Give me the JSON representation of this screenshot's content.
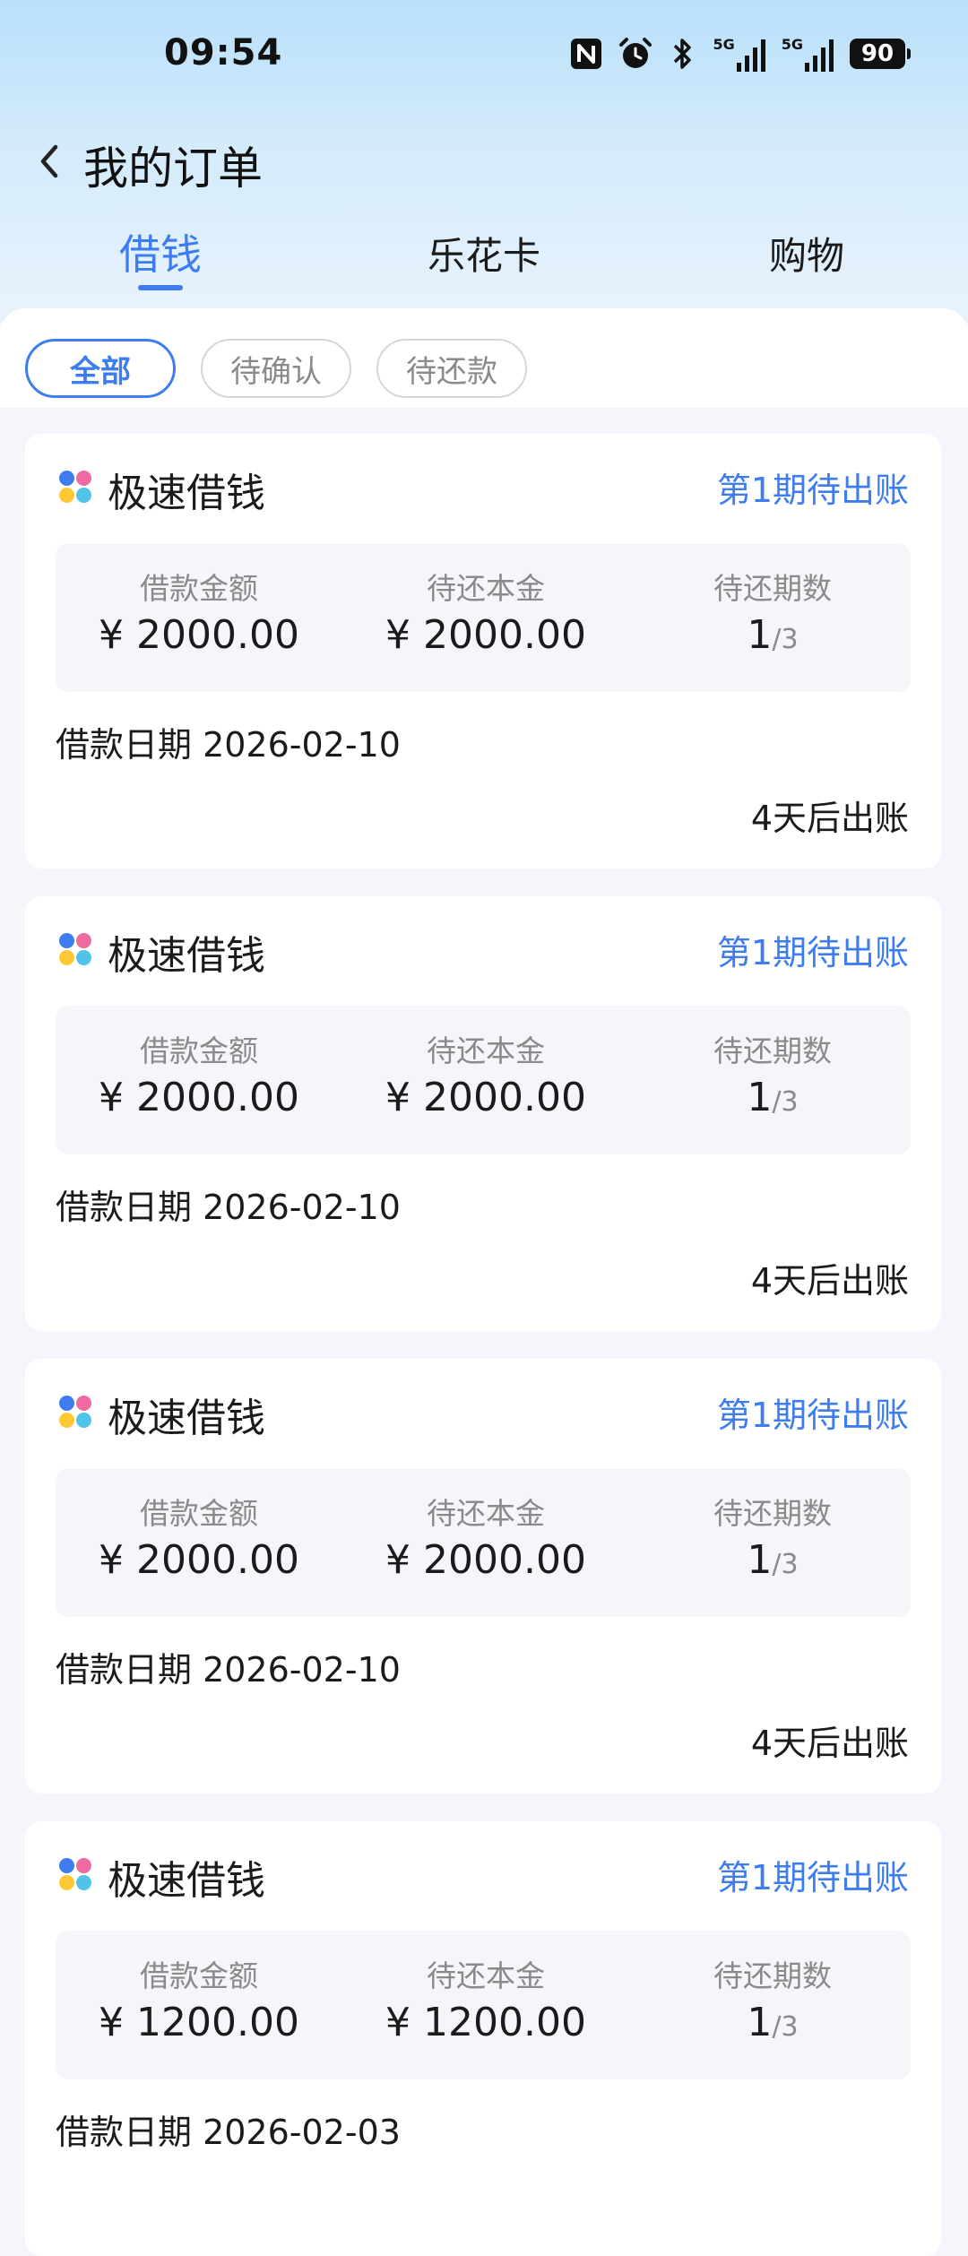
{
  "status_bar": {
    "time": "09:54",
    "network_1": "5G",
    "network_2": "5G",
    "battery": "90",
    "icons": [
      "nfc-icon",
      "alarm-icon",
      "bluetooth-icon",
      "signal-5g-icon",
      "signal-5g-icon",
      "battery-icon"
    ]
  },
  "nav": {
    "title": "我的订单",
    "back_icon": "chevron-left-icon"
  },
  "tabs": [
    {
      "label": "借钱",
      "active": true
    },
    {
      "label": "乐花卡",
      "active": false
    },
    {
      "label": "购物",
      "active": false
    }
  ],
  "filters": [
    {
      "label": "全部",
      "active": true
    },
    {
      "label": "待确认",
      "active": false
    },
    {
      "label": "待还款",
      "active": false
    }
  ],
  "colors": {
    "accent": "#3e7df0",
    "header_top": "#b9e0fb",
    "page_bg": "#f4f6fb",
    "card_inner_bg": "#f5f6fa"
  },
  "orders": [
    {
      "title": "极速借钱",
      "status": "第1期待出账",
      "loan_label": "借款金额",
      "loan_amount": "¥ 2000.00",
      "principal_label": "待还本金",
      "principal_amount": "¥ 2000.00",
      "periods_label": "待还期数",
      "period_current": "1",
      "period_total": "/3",
      "date_text": "借款日期 2026-02-10",
      "bill_text": "4天后出账"
    },
    {
      "title": "极速借钱",
      "status": "第1期待出账",
      "loan_label": "借款金额",
      "loan_amount": "¥ 2000.00",
      "principal_label": "待还本金",
      "principal_amount": "¥ 2000.00",
      "periods_label": "待还期数",
      "period_current": "1",
      "period_total": "/3",
      "date_text": "借款日期 2026-02-10",
      "bill_text": "4天后出账"
    },
    {
      "title": "极速借钱",
      "status": "第1期待出账",
      "loan_label": "借款金额",
      "loan_amount": "¥ 2000.00",
      "principal_label": "待还本金",
      "principal_amount": "¥ 2000.00",
      "periods_label": "待还期数",
      "period_current": "1",
      "period_total": "/3",
      "date_text": "借款日期 2026-02-10",
      "bill_text": "4天后出账"
    },
    {
      "title": "极速借钱",
      "status": "第1期待出账",
      "loan_label": "借款金额",
      "loan_amount": "¥ 1200.00",
      "principal_label": "待还本金",
      "principal_amount": "¥ 1200.00",
      "periods_label": "待还期数",
      "period_current": "1",
      "period_total": "/3",
      "date_text": "借款日期 2026-02-03",
      "bill_text": ""
    }
  ]
}
